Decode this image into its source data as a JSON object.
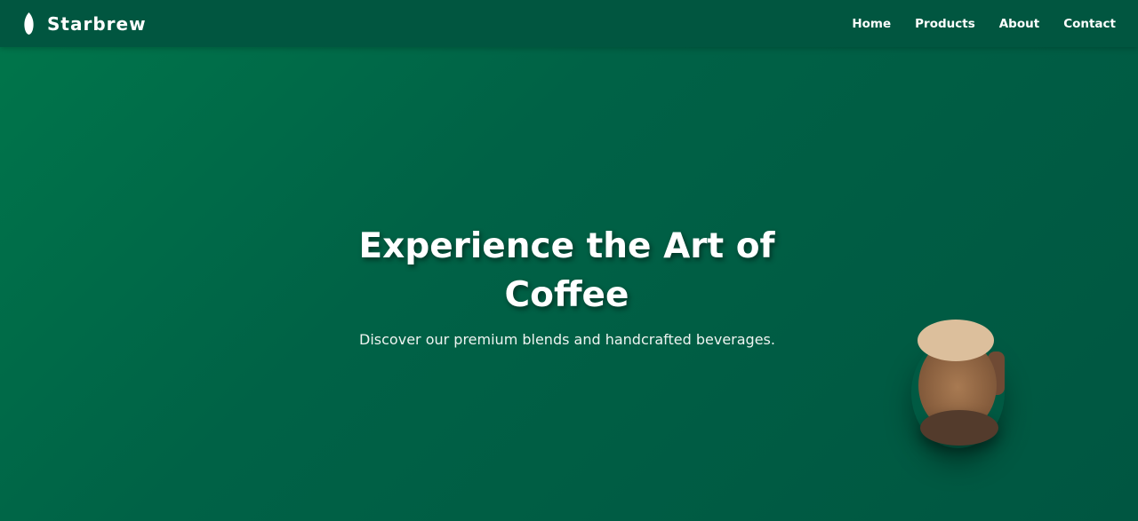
{
  "header": {
    "brand_name": "Starbrew",
    "logo_icon": "leaf-icon"
  },
  "nav": {
    "items": [
      {
        "label": "Home"
      },
      {
        "label": "Products"
      },
      {
        "label": "About"
      },
      {
        "label": "Contact"
      }
    ]
  },
  "hero": {
    "title": "Experience the Art of Coffee",
    "subtitle": "Discover our premium blends and handcrafted beverages.",
    "illustration_icon": "coffee-cup-icon"
  },
  "colors": {
    "primary_green": "#00704a",
    "header_green": "#015640",
    "text": "#ffffff"
  }
}
